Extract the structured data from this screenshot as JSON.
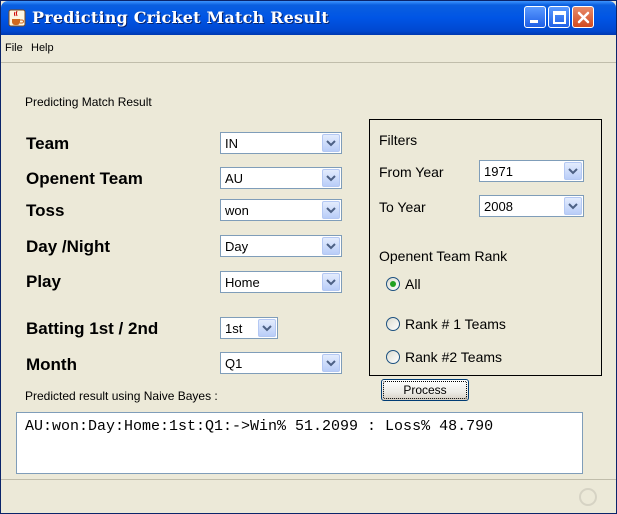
{
  "window": {
    "title": "Predicting Cricket Match Result",
    "icon": "java-cup-icon"
  },
  "menu": {
    "items": [
      {
        "label": "File"
      },
      {
        "label": "Help"
      }
    ]
  },
  "main": {
    "section_title": "Predicting Match Result",
    "fields": [
      {
        "label": "Team",
        "value": "IN"
      },
      {
        "label": "Openent Team",
        "value": "AU"
      },
      {
        "label": "Toss",
        "value": "won"
      },
      {
        "label": "Day /Night",
        "value": "Day"
      },
      {
        "label": "Play",
        "value": "Home"
      },
      {
        "label": "Batting 1st / 2nd",
        "value": "1st"
      },
      {
        "label": "Month",
        "value": "Q1"
      }
    ],
    "result_label": "Predicted result using Naive Bayes :",
    "result_text": "AU:won:Day:Home:1st:Q1:->Win% 51.2099 : Loss% 48.790"
  },
  "filters": {
    "title": "Filters",
    "from_year_label": "From Year",
    "from_year_value": "1971",
    "to_year_label": "To Year",
    "to_year_value": "2008",
    "rank_title": "Openent Team Rank",
    "rank_options": [
      {
        "label": "All",
        "selected": true
      },
      {
        "label": "Rank # 1 Teams",
        "selected": false
      },
      {
        "label": "Rank #2 Teams",
        "selected": false
      }
    ]
  },
  "actions": {
    "process_label": "Process"
  },
  "colors": {
    "titlebar": "#0055e5",
    "window_bg": "#ece9d8",
    "radio_selected": "#21a121"
  }
}
